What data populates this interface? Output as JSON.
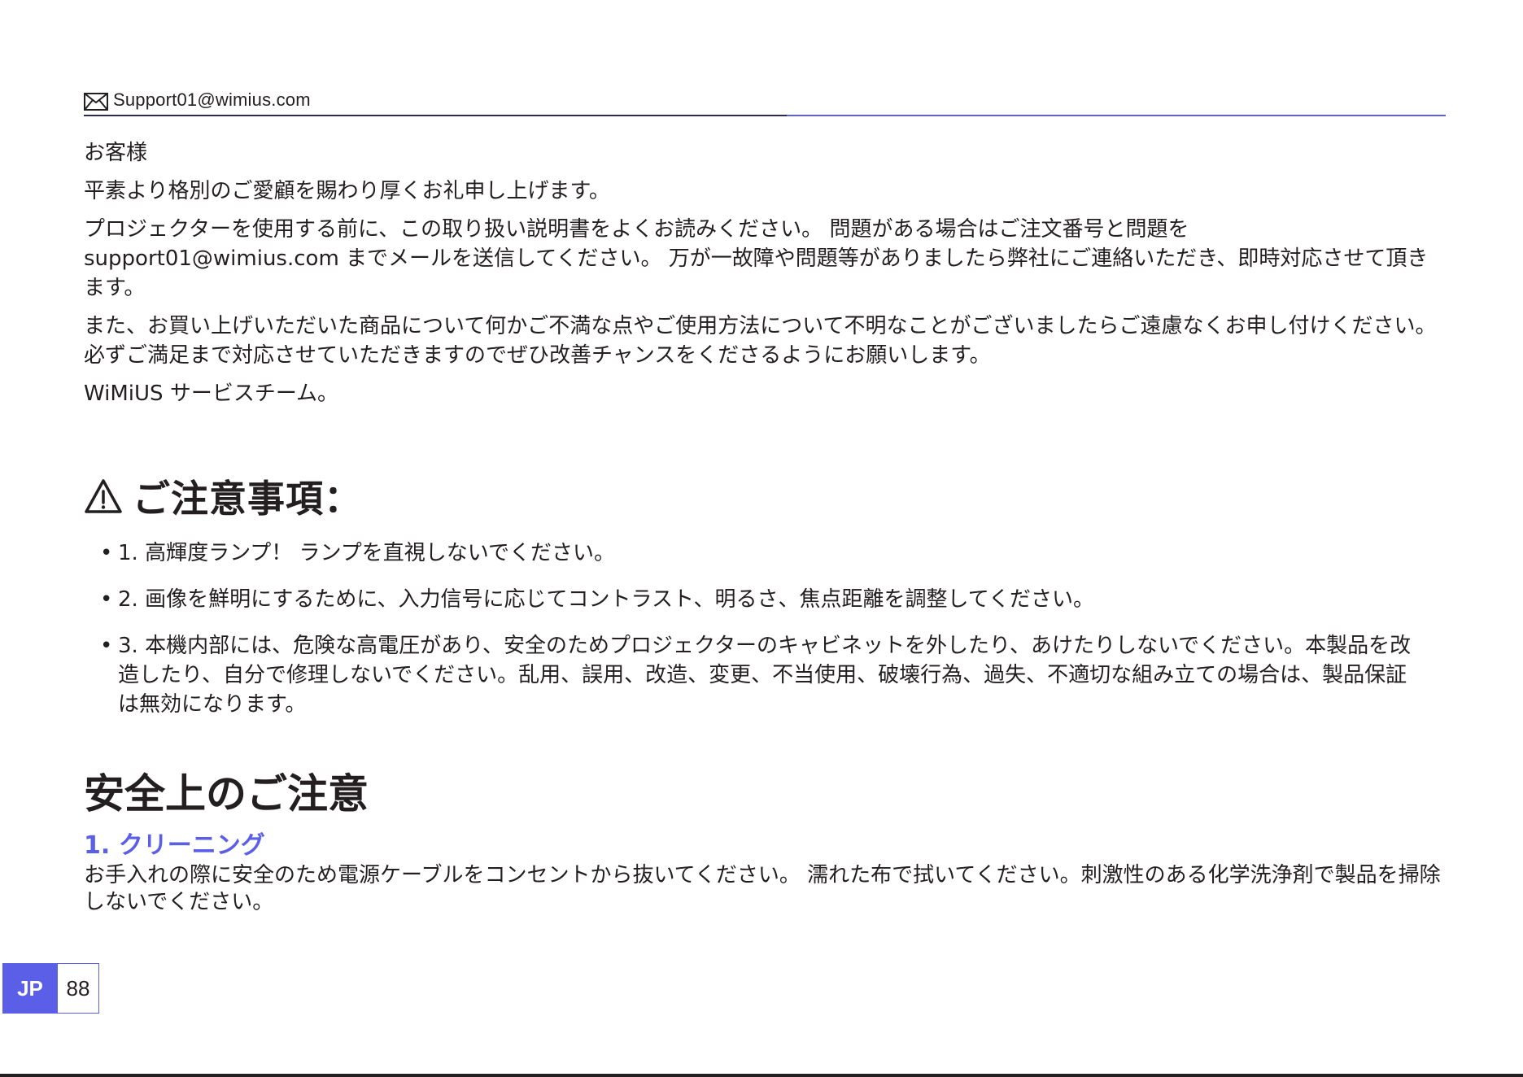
{
  "header": {
    "email": "Support01@wimius.com",
    "icon": "mail-icon"
  },
  "greeting": {
    "salutation": "お客様",
    "line1": "平素より格別のご愛顧を賜わり厚くお礼申し上げます。",
    "line2": "プロジェクターを使用する前に、この取り扱い説明書をよくお読みください。 問題がある場合はご注文番号と問題を support01@wimius.com までメールを送信してください。 万が一故障や問題等がありましたら弊社にご連絡いただき、即時対応させて頂きます。",
    "line3": "また、お買い上げいただいた商品について何かご不満な点やご使用方法について不明なことがございましたらご遠慮なくお申し付けください。必ずご満足まで対応させていただきますのでぜひ改善チャンスをくださるようにお願いします。",
    "signature": "WiMiUS サービスチーム。"
  },
  "notice": {
    "title": "ご注意事項：",
    "icon": "warning-icon",
    "items": [
      "1. 高輝度ランプ！ ランプを直視しないでください。",
      "2. 画像を鮮明にするために、入力信号に応じてコントラスト、明るさ、焦点距離を調整してください。",
      "3. 本機内部には、危険な高電圧があり、安全のためプロジェクターのキャビネットを外したり、あけたりしないでください。本製品を改造したり、自分で修理しないでください。乱用、誤用、改造、変更、不当使用、破壊行為、過失、不適切な組み立ての場合は、製品保証は無効になります。"
    ]
  },
  "safety": {
    "title": "安全上のご注意",
    "section1_title": "1. クリーニング",
    "section1_text": "お手入れの際に安全のため電源ケーブルをコンセントから抜いてください。 濡れた布で拭いてください。刺激性のある化学洗浄剤で製品を掃除しないでください。"
  },
  "footer": {
    "lang": "JP",
    "page": "88"
  },
  "colors": {
    "accent": "#5b5ee6",
    "text": "#231f20",
    "rule_dark": "#2a2a55"
  }
}
